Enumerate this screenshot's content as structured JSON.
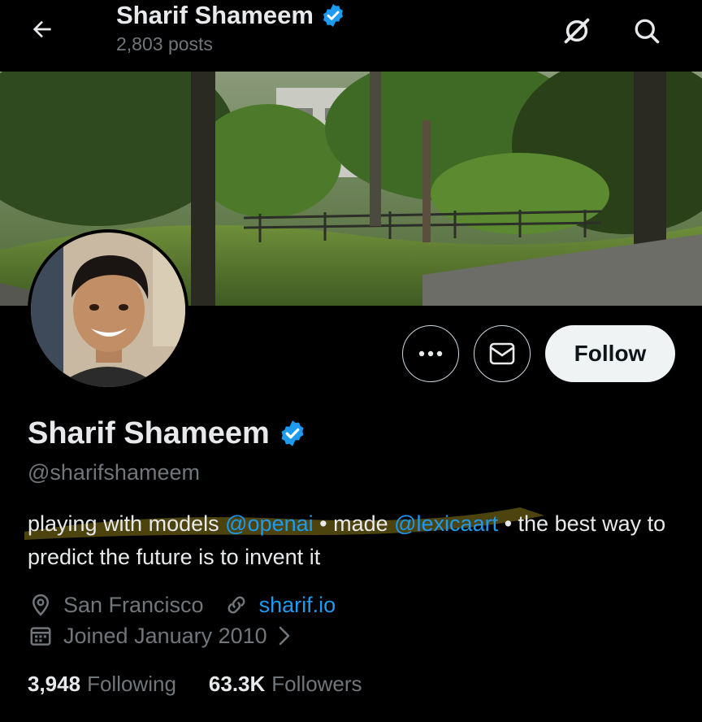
{
  "header": {
    "name": "Sharif Shameem",
    "posts_count": "2,803 posts"
  },
  "profile": {
    "name": "Sharif Shameem",
    "handle": "@sharifshameem",
    "bio": {
      "part1": "playing with models ",
      "mention1": "@openai",
      "part2": " • made ",
      "mention2": "@lexicaart",
      "part3": " • the best way to predict the future is to invent it"
    },
    "location": "San Francisco",
    "website": "sharif.io",
    "joined": "Joined January 2010",
    "following_count": "3,948",
    "following_label": "Following",
    "followers_count": "63.3K",
    "followers_label": "Followers"
  },
  "actions": {
    "follow_label": "Follow"
  },
  "colors": {
    "background": "#000000",
    "text_primary": "#e7e9ea",
    "text_secondary": "#71767b",
    "accent": "#1d9bf0",
    "follow_button_bg": "#eff3f4",
    "highlight": "#8a7a1c"
  },
  "icons": {
    "back": "arrow-left-icon",
    "verified": "verified-badge-icon",
    "grok": "grok-icon",
    "search": "search-icon",
    "more": "more-dots-icon",
    "message": "mail-icon",
    "location": "location-pin-icon",
    "website": "link-icon",
    "joined": "calendar-icon",
    "chevron": "chevron-right-icon"
  }
}
